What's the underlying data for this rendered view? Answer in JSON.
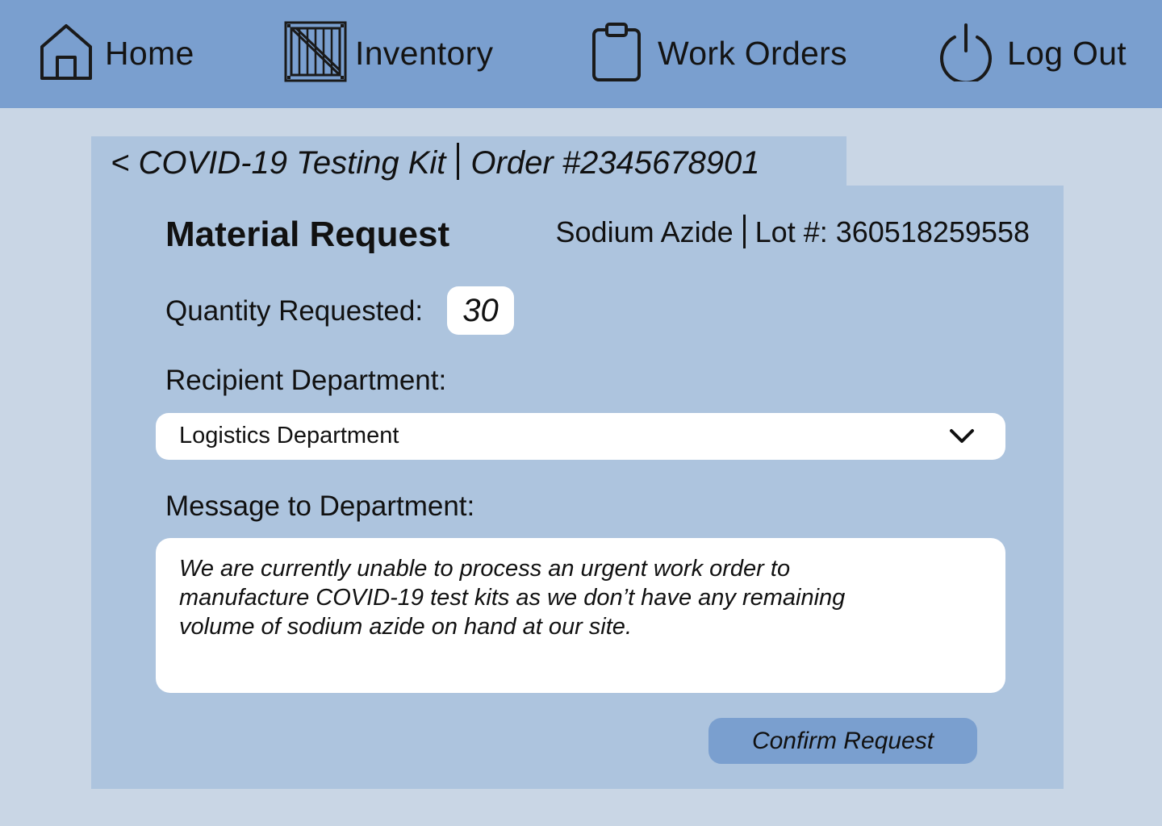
{
  "nav": {
    "home": {
      "label": "Home",
      "icon": "home-icon"
    },
    "inventory": {
      "label": "Inventory",
      "icon": "crate-icon"
    },
    "work_orders": {
      "label": "Work Orders",
      "icon": "clipboard-icon"
    },
    "logout": {
      "label": "Log Out",
      "icon": "power-icon"
    }
  },
  "tab": {
    "back": "<",
    "product": "COVID-19 Testing Kit",
    "order": "Order #2345678901"
  },
  "form": {
    "heading": "Material Request",
    "material": "Sodium Azide",
    "lot": "Lot #: 360518259558",
    "quantity_label": "Quantity Requested:",
    "quantity_value": "30",
    "department_label": "Recipient Department:",
    "department_selected": "Logistics Department",
    "message_label": "Message to Department:",
    "message_value": "We are currently unable to process an urgent work order to\nmanufacture COVID-19 test kits as we don’t have any remaining\nvolume of sodium azide on hand at our site.",
    "confirm_label": "Confirm Request"
  },
  "colors": {
    "nav_bg": "#7a9fcf",
    "page_bg": "#c9d6e5",
    "panel_bg": "#adc4de",
    "button_bg": "#7a9fcf"
  }
}
